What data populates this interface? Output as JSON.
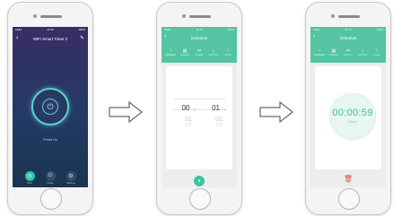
{
  "phone1": {
    "status": {
      "carrier": "●●●●",
      "time": "17:02",
      "battery": "100%"
    },
    "back_icon": "chevron-left-icon",
    "title": "WiFi Smart Timer 2",
    "edit_icon": "pencil-icon",
    "power_icon": "power-icon",
    "power_status": "Power On",
    "nav": [
      {
        "label": "Timer",
        "icon": "clock-icon",
        "active": true
      },
      {
        "label": "Power",
        "icon": "power-icon",
        "active": false
      },
      {
        "label": "Settings",
        "icon": "gear-icon",
        "active": false
      }
    ]
  },
  "phone2": {
    "status": {
      "carrier": "●●●●",
      "time": "11:14",
      "battery": "100%"
    },
    "title": "Schedule",
    "tabs": [
      {
        "label": "Countdown",
        "active": true
      },
      {
        "label": "Schedule",
        "active": false
      },
      {
        "label": "Random",
        "active": false
      },
      {
        "label": "Astronomic",
        "active": false
      },
      {
        "label": "Inching",
        "active": false
      }
    ],
    "picker": {
      "hours": {
        "selected": "00",
        "unit": "h",
        "next": "01",
        "next2": "02"
      },
      "minutes": {
        "selected": "01",
        "unit": "m",
        "next": "02",
        "next2": "03"
      }
    },
    "confirm_icon": "check-circle-icon"
  },
  "phone3": {
    "status": {
      "carrier": "●●●●",
      "time": "11:14",
      "battery": "100%"
    },
    "title": "Schedule",
    "tabs": [
      {
        "label": "Countdown",
        "active": true
      },
      {
        "label": "Schedule",
        "active": false
      },
      {
        "label": "Random",
        "active": false
      },
      {
        "label": "Astronomic",
        "active": false
      },
      {
        "label": "Inching",
        "active": false
      }
    ],
    "countdown": "00:00:59",
    "countdown_sub": "Reset",
    "delete_icon": "trash-icon"
  },
  "colors": {
    "accent_green": "#55c4a2",
    "teal_ring": "#5fd1c9",
    "dark_bg": "#24355d",
    "delete_red": "#e2504c"
  }
}
